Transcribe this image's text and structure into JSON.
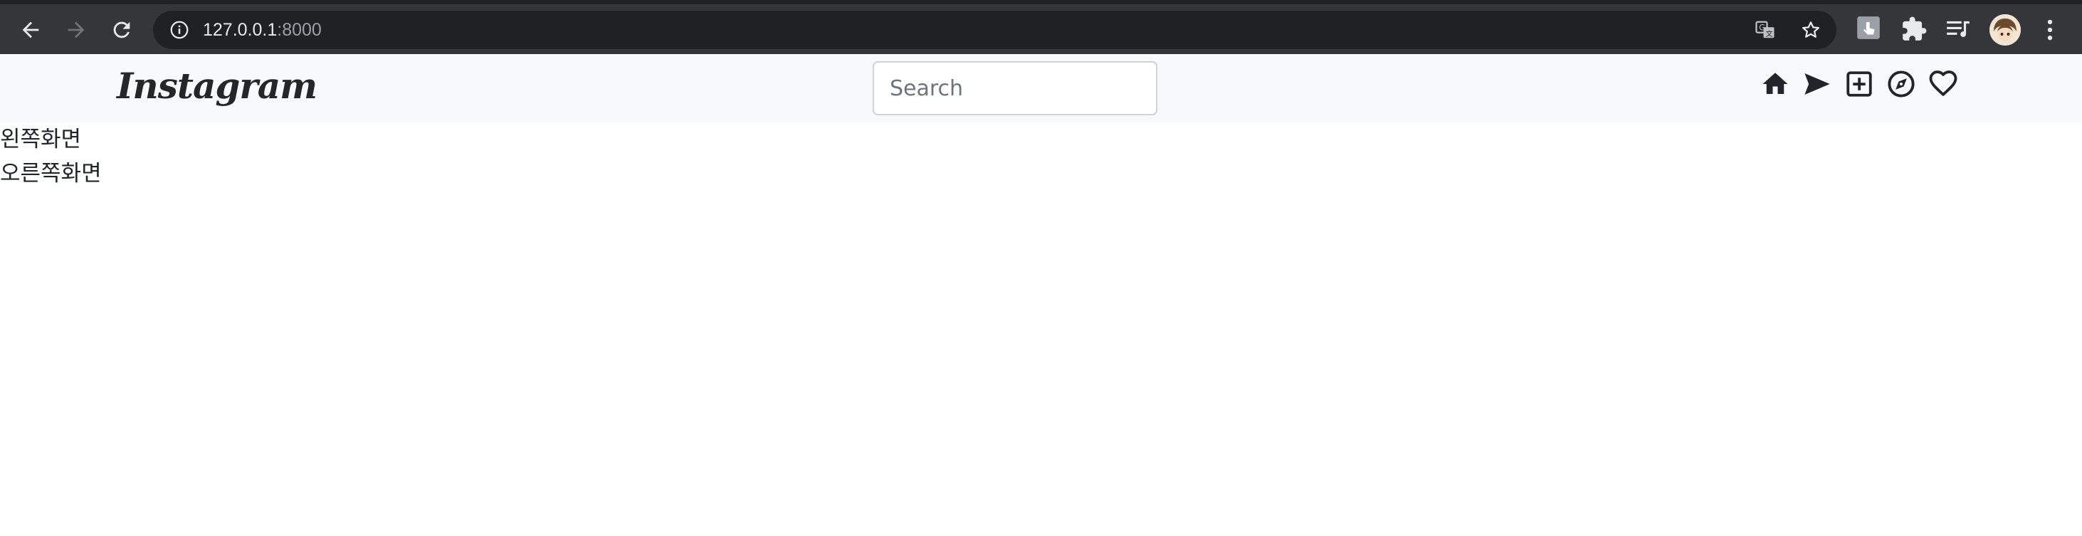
{
  "browser": {
    "url_host": "127.0.0.1",
    "url_port": ":8000",
    "icons": {
      "back": "back-arrow-icon",
      "forward": "forward-arrow-icon",
      "reload": "reload-icon",
      "site_info": "info-icon",
      "translate": "translate-icon",
      "bookmark": "star-icon",
      "extension_1": "extension-icon",
      "extensions": "puzzle-icon",
      "reading_list": "reading-list-icon",
      "profile": "avatar",
      "menu": "kebab-menu-icon"
    }
  },
  "navbar": {
    "brand": "Instagram",
    "search_placeholder": "Search",
    "icons": [
      "home-icon",
      "send-icon",
      "plus-square-icon",
      "compass-icon",
      "heart-icon"
    ]
  },
  "content": {
    "left_text": "왼쪽화면",
    "right_text": "오른쪽화면"
  },
  "colors": {
    "chrome_bg": "#35363a",
    "omnibox_bg": "#202124",
    "navbar_bg": "#f8f9fa",
    "text": "#212529"
  }
}
